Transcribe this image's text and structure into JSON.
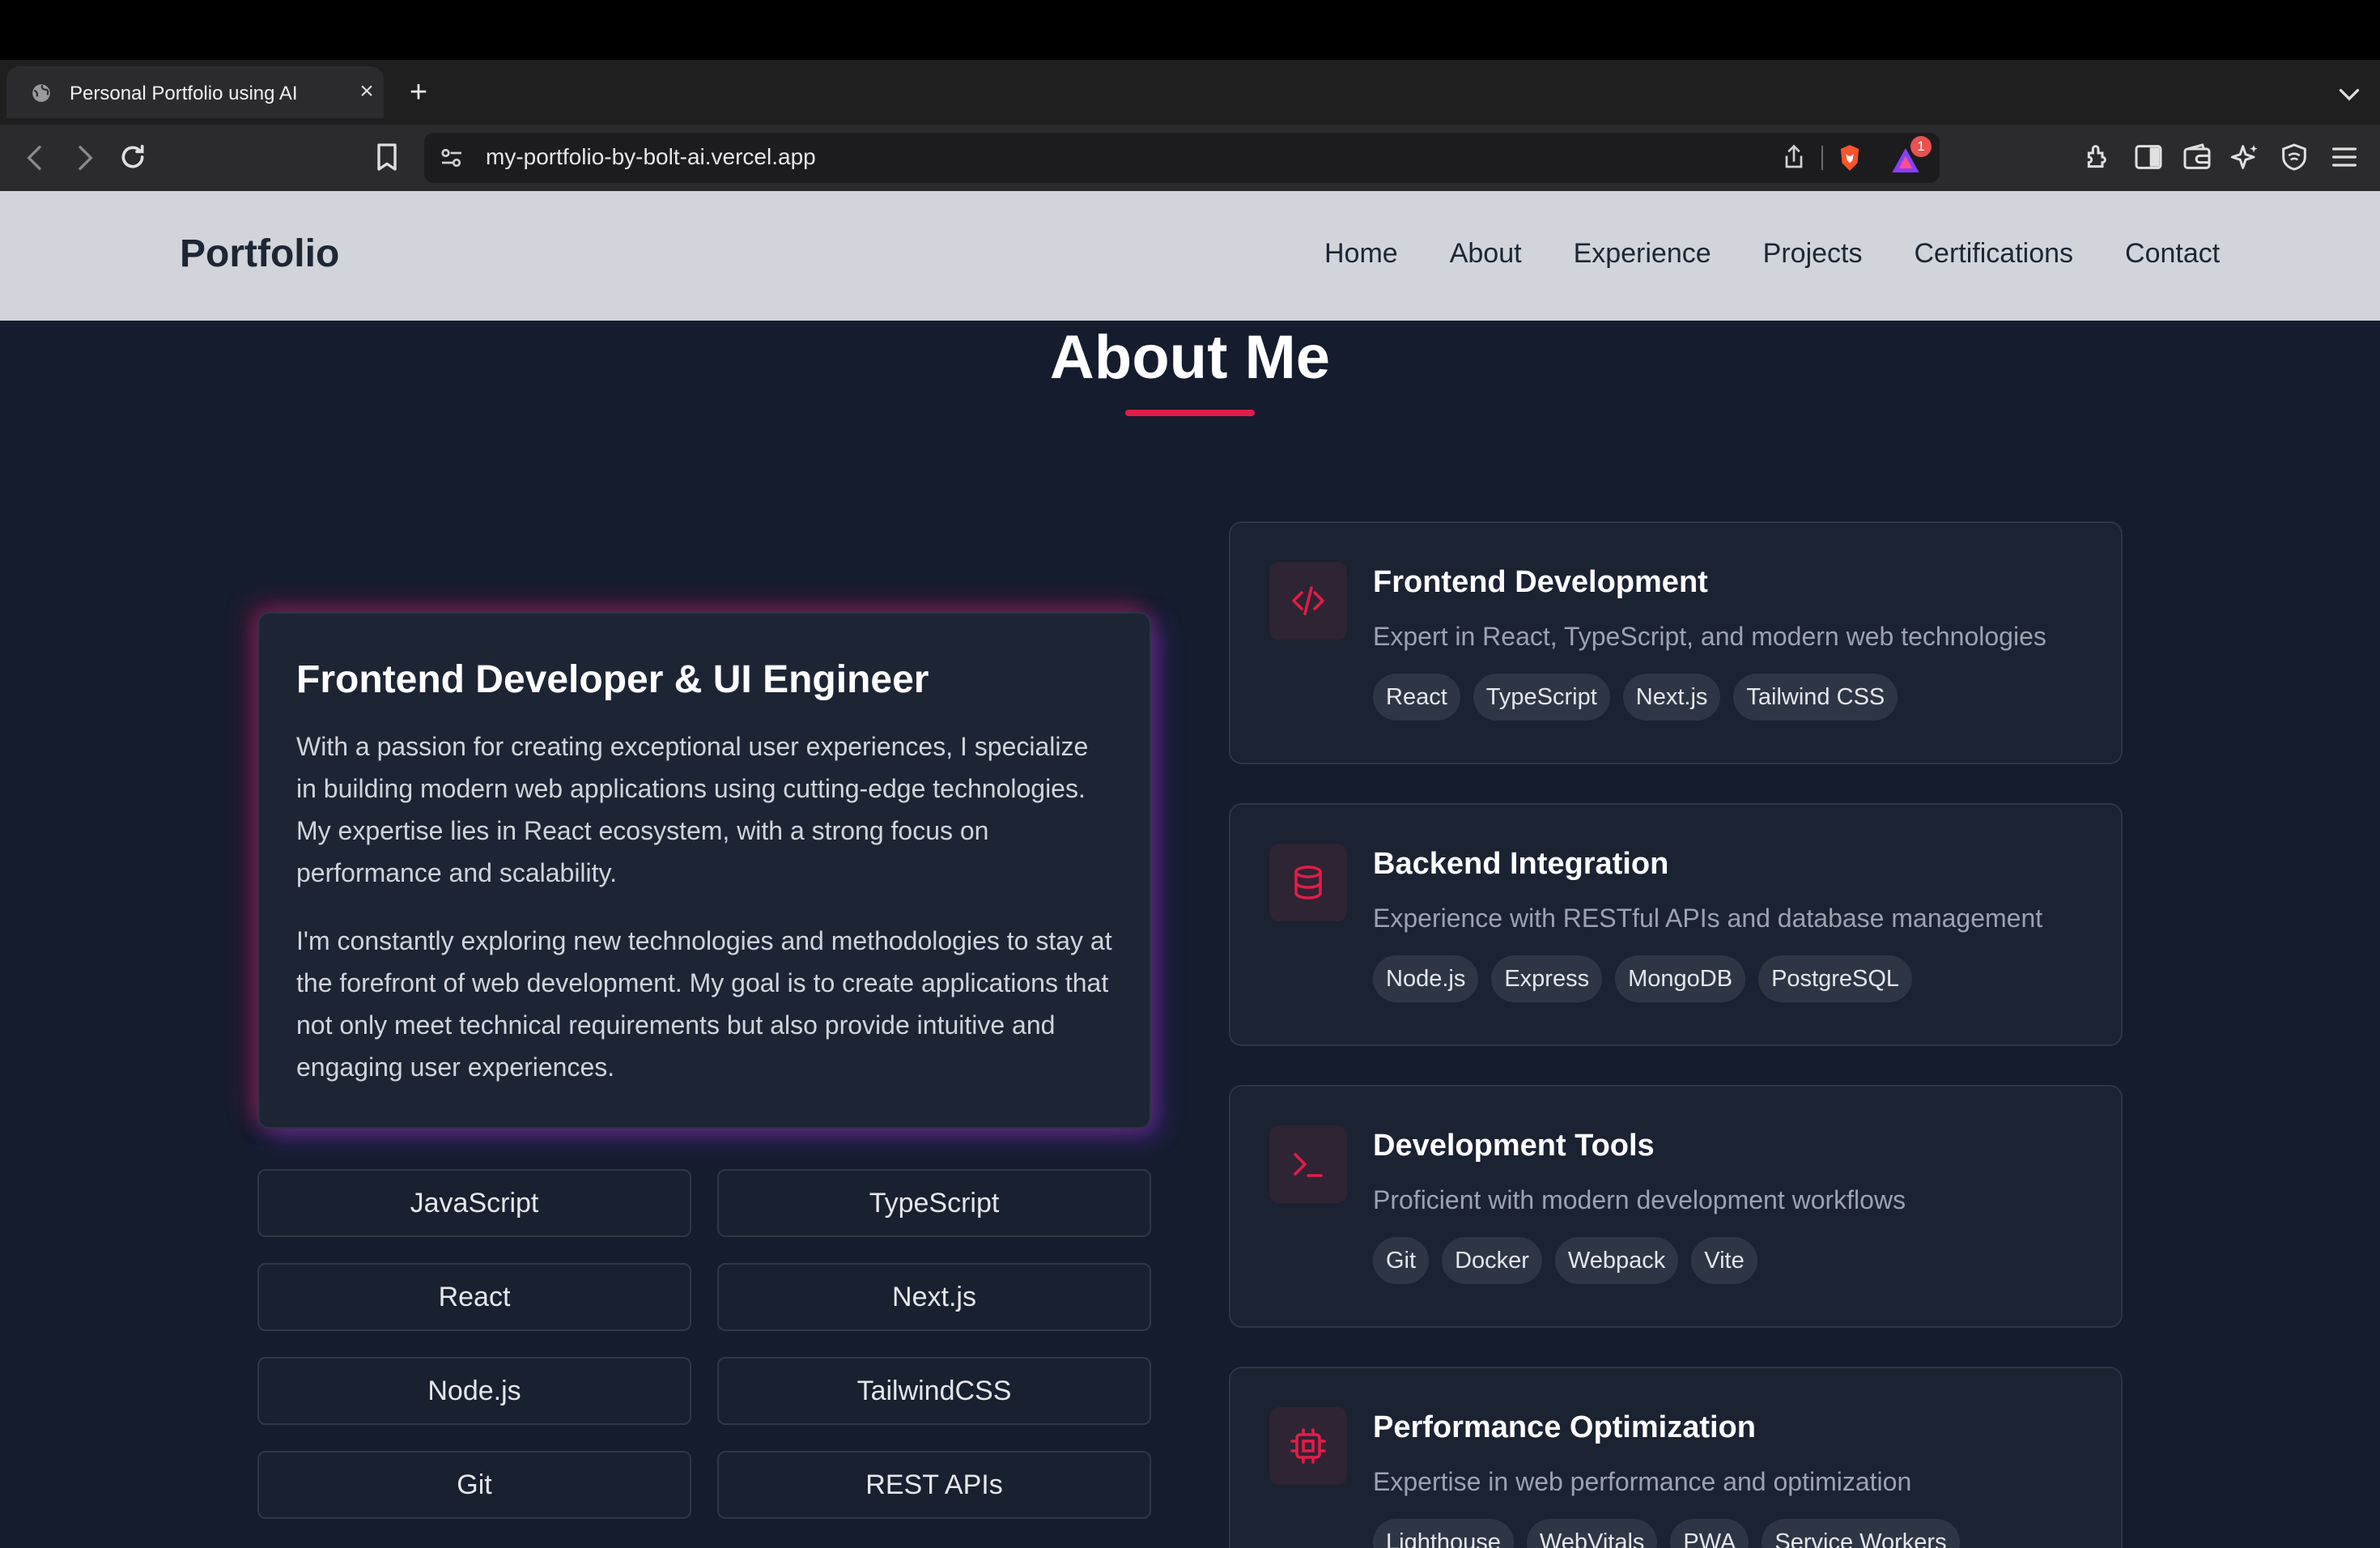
{
  "browser": {
    "tab_title": "Personal Portfolio using AI",
    "tab_close": "×",
    "new_tab": "+",
    "url": "my-portfolio-by-bolt-ai.vercel.app",
    "rewards_badge": "1"
  },
  "site": {
    "brand": "Portfolio",
    "nav": [
      "Home",
      "About",
      "Experience",
      "Projects",
      "Certifications",
      "Contact"
    ]
  },
  "about": {
    "title": "About Me",
    "intro": {
      "heading": "Frontend Developer & UI Engineer",
      "p1": "With a passion for creating exceptional user experiences, I specialize in building modern web applications using cutting-edge technologies. My expertise lies in React ecosystem, with a strong focus on performance and scalability.",
      "p2": "I'm constantly exploring new technologies and methodologies to stay at the forefront of web development. My goal is to create applications that not only meet technical requirements but also provide intuitive and engaging user experiences."
    },
    "skills": [
      "JavaScript",
      "TypeScript",
      "React",
      "Next.js",
      "Node.js",
      "TailwindCSS",
      "Git",
      "REST APIs"
    ],
    "features": [
      {
        "icon": "code-icon",
        "title": "Frontend Development",
        "desc": "Expert in React, TypeScript, and modern web technologies",
        "tags": [
          "React",
          "TypeScript",
          "Next.js",
          "Tailwind CSS"
        ]
      },
      {
        "icon": "database-icon",
        "title": "Backend Integration",
        "desc": "Experience with RESTful APIs and database management",
        "tags": [
          "Node.js",
          "Express",
          "MongoDB",
          "PostgreSQL"
        ]
      },
      {
        "icon": "terminal-icon",
        "title": "Development Tools",
        "desc": "Proficient with modern development workflows",
        "tags": [
          "Git",
          "Docker",
          "Webpack",
          "Vite"
        ]
      },
      {
        "icon": "cpu-icon",
        "title": "Performance Optimization",
        "desc": "Expertise in web performance and optimization",
        "tags": [
          "Lighthouse",
          "WebVitals",
          "PWA",
          "Service Workers"
        ]
      }
    ]
  },
  "colors": {
    "accent": "#e11d48",
    "page_bg": "#151c2e",
    "nav_bg": "#d1d5db"
  }
}
